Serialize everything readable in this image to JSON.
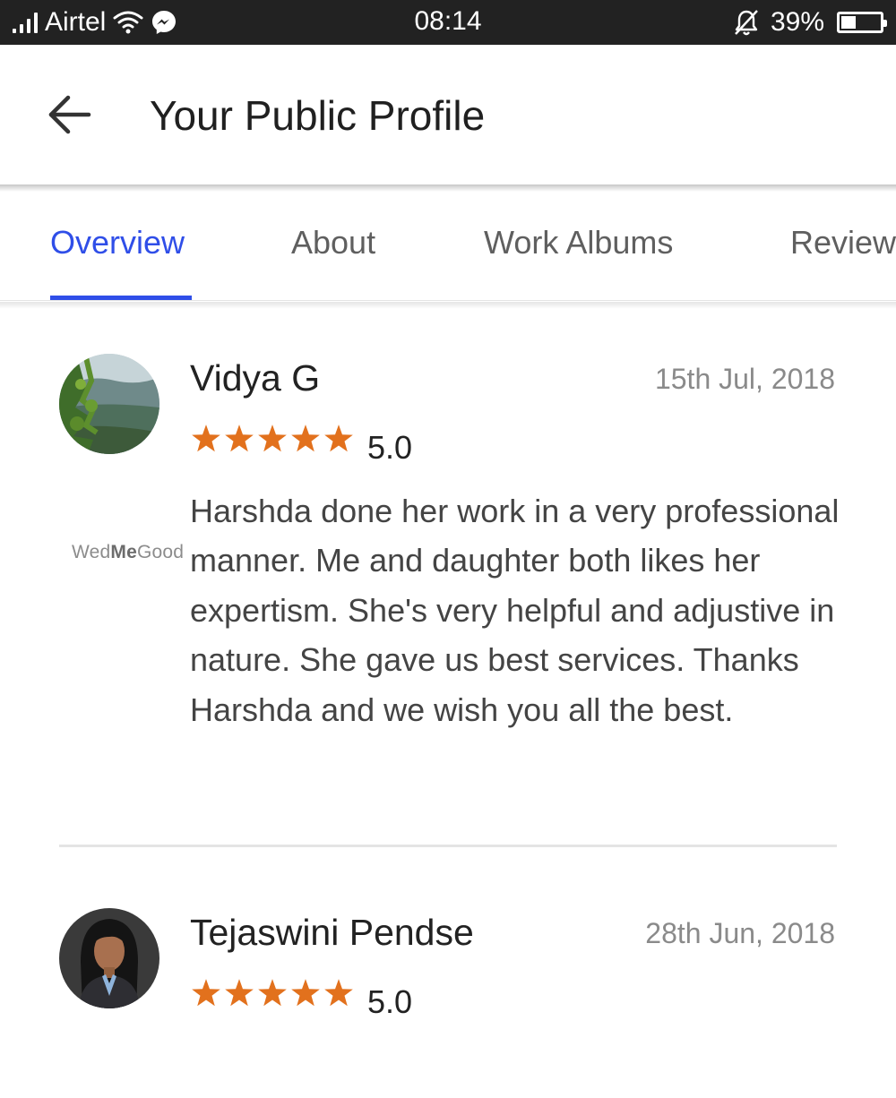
{
  "status_bar": {
    "carrier": "Airtel",
    "time": "08:14",
    "battery_percent": "39%",
    "battery_level": 0.39,
    "icons": [
      "signal-icon",
      "wifi-icon",
      "messenger-icon",
      "bell-off-icon",
      "battery-icon"
    ]
  },
  "app_bar": {
    "back_icon": "arrow-left-icon",
    "title": "Your Public Profile"
  },
  "tabs": [
    {
      "label": "Overview",
      "active": true
    },
    {
      "label": "About",
      "active": false
    },
    {
      "label": "Work Albums",
      "active": false
    },
    {
      "label": "Reviews",
      "active": false
    }
  ],
  "colors": {
    "accent": "#2f4ee8",
    "star": "#e2711d",
    "status_bar": "#222222"
  },
  "reviews": [
    {
      "name": "Vidya G",
      "date": "15th Jul, 2018",
      "stars": 5,
      "rating": "5.0",
      "text": "Harshda done her work in a very professional manner. Me and daughter both likes her expertism. She's very helpful and adjustive in nature. She gave us best services. Thanks Harshda and we wish you all the best.",
      "watermark_prefix": "Wed",
      "watermark_bold": "Me",
      "watermark_suffix": "Good"
    },
    {
      "name": "Tejaswini Pendse",
      "date": "28th Jun, 2018",
      "stars": 5,
      "rating": "5.0"
    }
  ]
}
